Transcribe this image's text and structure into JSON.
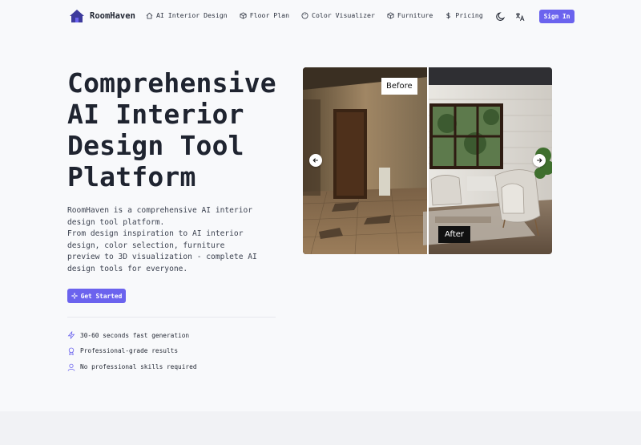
{
  "header": {
    "brand": "RoomHaven",
    "nav": [
      {
        "label": "AI Interior Design",
        "icon": "home-icon"
      },
      {
        "label": "Floor Plan",
        "icon": "cube-icon"
      },
      {
        "label": "Color Visualizer",
        "icon": "palette-icon"
      },
      {
        "label": "Furniture",
        "icon": "box-icon"
      },
      {
        "label": "Pricing",
        "icon": "dollar-icon"
      }
    ],
    "sign_in": "Sign In"
  },
  "hero": {
    "title": "Comprehensive AI Interior Design Tool Platform",
    "description_1": "RoomHaven is a comprehensive AI interior design tool platform.",
    "description_2": "From design inspiration to AI interior design, color selection, furniture preview to 3D visualization - complete AI design tools for everyone.",
    "cta": "Get Started",
    "features": [
      {
        "label": "30-60 seconds fast generation",
        "icon": "lightning-icon"
      },
      {
        "label": "Professional-grade results",
        "icon": "award-icon"
      },
      {
        "label": "No professional skills required",
        "icon": "user-icon"
      }
    ]
  },
  "compare": {
    "before_label": "Before",
    "after_label": "After"
  },
  "colors": {
    "accent": "#6b63ee",
    "background": "#f8f9fb"
  }
}
